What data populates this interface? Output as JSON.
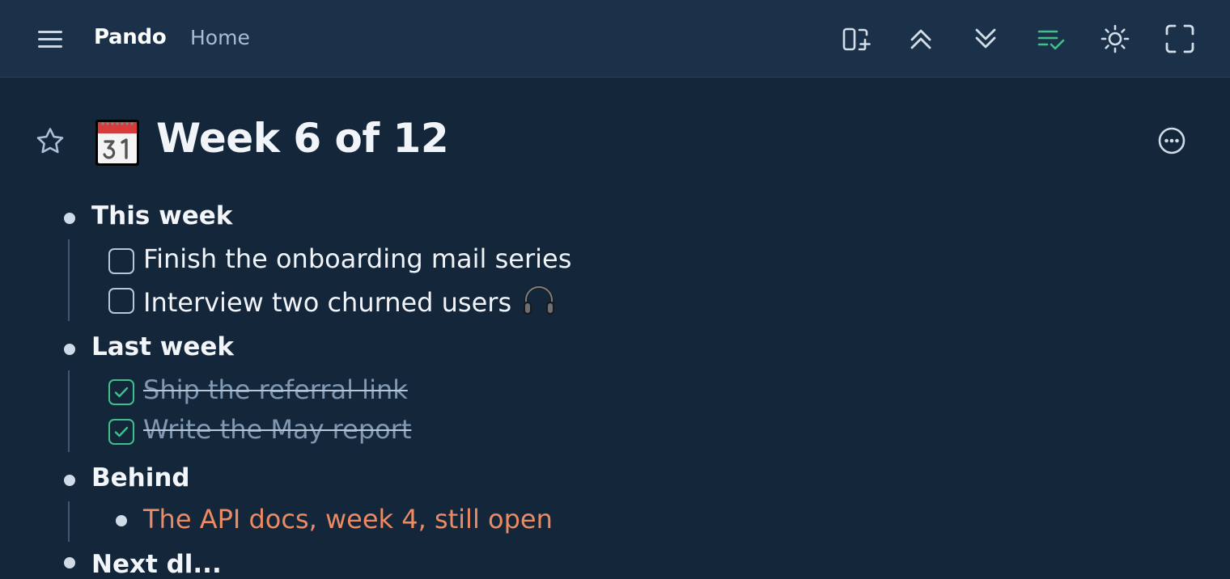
{
  "app": {
    "name": "Pando",
    "breadcrumb": "Home"
  },
  "toolbar": {
    "icons": [
      "add-panel-icon",
      "collapse-all-icon",
      "expand-all-icon",
      "task-list-icon",
      "theme-icon",
      "fullscreen-icon"
    ],
    "accent": "#3fc08a"
  },
  "page": {
    "title": "Week 6 of 12",
    "title_icon": "calendar-icon",
    "sections": [
      {
        "label": "This week",
        "tasks": [
          {
            "text": "Finish the onboarding mail series",
            "done": false
          },
          {
            "text": "Interview two churned users",
            "done": false,
            "icon": "headphones-icon"
          }
        ]
      },
      {
        "label": "Last week",
        "tasks": [
          {
            "text": "Ship the referral link",
            "done": true
          },
          {
            "text": "Write the May report",
            "done": true
          }
        ]
      },
      {
        "label": "Behind",
        "items": [
          {
            "text": "The API docs, week 4, still open",
            "color": "#ec8a63"
          }
        ]
      },
      {
        "label": "Next dl..."
      }
    ]
  }
}
